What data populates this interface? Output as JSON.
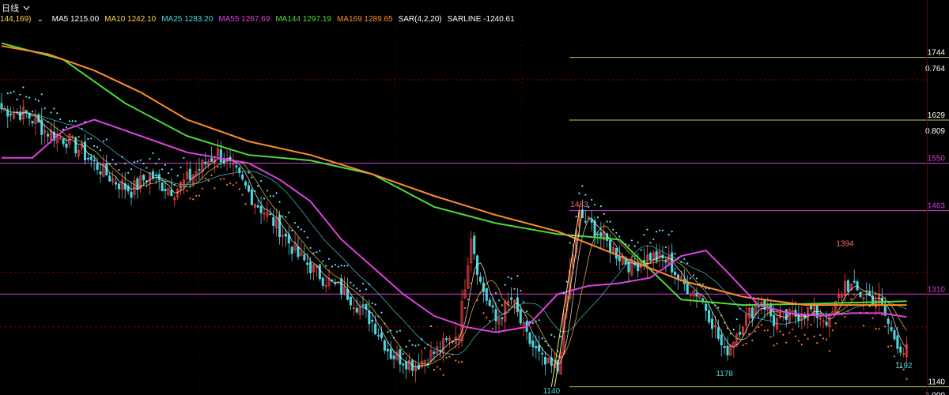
{
  "header": {
    "tab_label": "日线",
    "params_label": "144,169)"
  },
  "indicators": [
    {
      "label": "MA5 1215.00",
      "color": "#ffffff"
    },
    {
      "label": "MA10 1242.10",
      "color": "#ffd84a"
    },
    {
      "label": "MA25 1283.20",
      "color": "#4fd6e0"
    },
    {
      "label": "MA55 1267.69",
      "color": "#e040e0"
    },
    {
      "label": "MA144 1297.19",
      "color": "#4fdc3a"
    },
    {
      "label": "MA169 1289.65",
      "color": "#ff8c2a"
    },
    {
      "label": "SAR(4,2,20)",
      "color": "#ffffff"
    },
    {
      "label": "SARLINE -1240.61",
      "color": "#ffffff"
    }
  ],
  "chart_data": {
    "type": "candlestick",
    "y_range": [
      1125,
      1800
    ],
    "x_count": 300,
    "horizontal_levels": [
      {
        "label": "1550",
        "value": 1550,
        "color": "#d040d0"
      },
      {
        "label": "1463",
        "value": 1463,
        "color": "#d040d0"
      },
      {
        "label": "1310",
        "value": 1310,
        "color": "#d040d0"
      }
    ],
    "reference_lines": [
      {
        "label": "1744",
        "value": 1744,
        "color": "#c8c850"
      },
      {
        "label": "1629",
        "value": 1629,
        "color": "#c8c850"
      },
      {
        "label": "1140",
        "value": 1140,
        "color": "#c8c850"
      }
    ],
    "ratio_labels": [
      {
        "label": "0.764",
        "value": 1725
      },
      {
        "label": "0.809",
        "value": 1610
      },
      {
        "label": "1.000",
        "value": 1126
      }
    ],
    "dashed_levels": [
      1703,
      1350,
      1250
    ],
    "price_annotations": [
      {
        "label": "1463",
        "x": 187,
        "value": 1470,
        "color": "#ff6a6a"
      },
      {
        "label": "1394",
        "x": 273,
        "value": 1398,
        "color": "#ff6a6a"
      },
      {
        "label": "1178",
        "x": 234,
        "value": 1160,
        "color": "#4fd6e0"
      },
      {
        "label": "1192",
        "x": 292,
        "value": 1174,
        "color": "#4fd6e0"
      },
      {
        "label": "1140",
        "x": 178,
        "value": 1128,
        "color": "#4fd6e0"
      }
    ],
    "anchors": [
      [
        0,
        1650
      ],
      [
        8,
        1640
      ],
      [
        14,
        1610
      ],
      [
        22,
        1590
      ],
      [
        28,
        1560
      ],
      [
        36,
        1520
      ],
      [
        42,
        1500
      ],
      [
        48,
        1530
      ],
      [
        52,
        1510
      ],
      [
        56,
        1500
      ],
      [
        62,
        1530
      ],
      [
        70,
        1570
      ],
      [
        76,
        1530
      ],
      [
        82,
        1480
      ],
      [
        90,
        1430
      ],
      [
        96,
        1380
      ],
      [
        104,
        1340
      ],
      [
        112,
        1310
      ],
      [
        120,
        1260
      ],
      [
        126,
        1200
      ],
      [
        134,
        1180
      ],
      [
        142,
        1210
      ],
      [
        148,
        1240
      ],
      [
        152,
        1420
      ],
      [
        155,
        1330
      ],
      [
        160,
        1260
      ],
      [
        165,
        1300
      ],
      [
        170,
        1230
      ],
      [
        176,
        1180
      ],
      [
        180,
        1170
      ],
      [
        184,
        1350
      ],
      [
        187,
        1455
      ],
      [
        192,
        1430
      ],
      [
        198,
        1390
      ],
      [
        204,
        1360
      ],
      [
        210,
        1380
      ],
      [
        216,
        1370
      ],
      [
        220,
        1330
      ],
      [
        226,
        1310
      ],
      [
        230,
        1260
      ],
      [
        234,
        1200
      ],
      [
        240,
        1260
      ],
      [
        246,
        1300
      ],
      [
        250,
        1260
      ],
      [
        256,
        1270
      ],
      [
        262,
        1280
      ],
      [
        268,
        1260
      ],
      [
        273,
        1330
      ],
      [
        278,
        1310
      ],
      [
        284,
        1300
      ],
      [
        288,
        1240
      ],
      [
        292,
        1205
      ],
      [
        293,
        1205
      ]
    ],
    "ma_series": [
      {
        "name": "MA144",
        "color": "#4fdc3a",
        "points": [
          [
            0,
            1770
          ],
          [
            20,
            1740
          ],
          [
            40,
            1660
          ],
          [
            60,
            1600
          ],
          [
            80,
            1565
          ],
          [
            100,
            1555
          ],
          [
            120,
            1530
          ],
          [
            140,
            1470
          ],
          [
            160,
            1440
          ],
          [
            180,
            1420
          ],
          [
            200,
            1410
          ],
          [
            220,
            1300
          ],
          [
            240,
            1290
          ],
          [
            260,
            1292
          ],
          [
            280,
            1295
          ],
          [
            293,
            1297
          ]
        ]
      },
      {
        "name": "MA169",
        "color": "#ff8c2a",
        "points": [
          [
            0,
            1765
          ],
          [
            15,
            1750
          ],
          [
            30,
            1720
          ],
          [
            45,
            1680
          ],
          [
            60,
            1630
          ],
          [
            80,
            1590
          ],
          [
            100,
            1565
          ],
          [
            120,
            1530
          ],
          [
            140,
            1490
          ],
          [
            160,
            1455
          ],
          [
            180,
            1425
          ],
          [
            200,
            1380
          ],
          [
            220,
            1335
          ],
          [
            240,
            1305
          ],
          [
            260,
            1290
          ],
          [
            280,
            1290
          ],
          [
            293,
            1290
          ]
        ]
      },
      {
        "name": "MA55",
        "color": "#e040e0",
        "points": [
          [
            0,
            1560
          ],
          [
            10,
            1560
          ],
          [
            20,
            1610
          ],
          [
            30,
            1630
          ],
          [
            40,
            1610
          ],
          [
            50,
            1590
          ],
          [
            60,
            1570
          ],
          [
            70,
            1560
          ],
          [
            80,
            1550
          ],
          [
            90,
            1520
          ],
          [
            100,
            1480
          ],
          [
            110,
            1410
          ],
          [
            120,
            1360
          ],
          [
            130,
            1310
          ],
          [
            140,
            1270
          ],
          [
            150,
            1250
          ],
          [
            160,
            1240
          ],
          [
            170,
            1250
          ],
          [
            180,
            1310
          ],
          [
            190,
            1325
          ],
          [
            200,
            1330
          ],
          [
            210,
            1340
          ],
          [
            220,
            1380
          ],
          [
            228,
            1390
          ],
          [
            235,
            1350
          ],
          [
            245,
            1290
          ],
          [
            255,
            1275
          ],
          [
            265,
            1270
          ],
          [
            275,
            1275
          ],
          [
            285,
            1275
          ],
          [
            293,
            1268
          ]
        ]
      }
    ]
  }
}
